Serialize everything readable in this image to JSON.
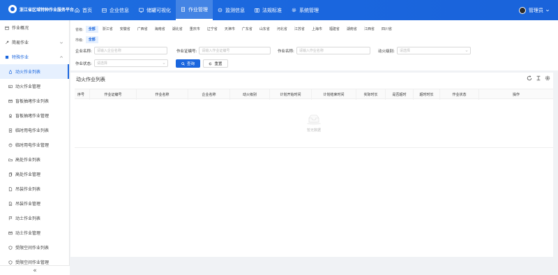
{
  "header": {
    "app_title": "浙江省区域特种作业服务平台",
    "nav": [
      {
        "label": "首页",
        "icon": "home-icon"
      },
      {
        "label": "企业信息",
        "icon": "company-icon"
      },
      {
        "label": "储罐可视化",
        "icon": "monitor-icon"
      },
      {
        "label": "作业管理",
        "icon": "document-icon",
        "active": true
      },
      {
        "label": "监测信息",
        "icon": "sensor-icon"
      },
      {
        "label": "法规标准",
        "icon": "book-icon"
      },
      {
        "label": "系统管理",
        "icon": "gear-icon"
      }
    ],
    "user": "管理员"
  },
  "sidebar": {
    "items": [
      {
        "label": "作业概况",
        "icon": "calendar-icon",
        "level": 0
      },
      {
        "label": "简易作业",
        "icon": "tool-icon",
        "level": 0,
        "chevron": "down"
      },
      {
        "label": "特殊作业",
        "icon": "square-icon",
        "level": 0,
        "chevron": "up",
        "open": true
      },
      {
        "label": "动火作业列表",
        "icon": "fire-icon",
        "level": 1,
        "active": true
      },
      {
        "label": "动火作业管理",
        "icon": "image-icon",
        "level": 1
      },
      {
        "label": "盲板抽堵作业列表",
        "icon": "mail-icon",
        "level": 1
      },
      {
        "label": "盲板抽堵作业管理",
        "icon": "badge-icon",
        "level": 1
      },
      {
        "label": "临时用电作业列表",
        "icon": "list-icon",
        "level": 1
      },
      {
        "label": "临时用电作业管理",
        "icon": "plug-icon",
        "level": 1
      },
      {
        "label": "高处作业列表",
        "icon": "folder-icon",
        "level": 1
      },
      {
        "label": "高处作业管理",
        "icon": "copy-icon",
        "level": 1
      },
      {
        "label": "吊装作业列表",
        "icon": "file-icon",
        "level": 1
      },
      {
        "label": "吊装作业管理",
        "icon": "file-check-icon",
        "level": 1
      },
      {
        "label": "动土作业列表",
        "icon": "flag-icon",
        "level": 1
      },
      {
        "label": "动土作业管理",
        "icon": "mail-icon",
        "level": 1
      },
      {
        "label": "受限空间作业列表",
        "icon": "shield-icon",
        "level": 1
      },
      {
        "label": "受限空间作业管理",
        "icon": "shield-icon",
        "level": 1
      }
    ],
    "collapse_label": "«"
  },
  "filters": {
    "province_label": "省级:",
    "provinces": [
      "全部",
      "浙江省",
      "安徽省",
      "广西省",
      "海南省",
      "湖北省",
      "重庆市",
      "辽宁省",
      "天津市",
      "广东省",
      "山东省",
      "河北省",
      "江苏省",
      "上海市",
      "福建省",
      "湖南省",
      "江西省",
      "四川省"
    ],
    "city_label": "市级:",
    "cities": [
      "全部"
    ],
    "company_name": {
      "label": "企业名称:",
      "placeholder": "请输入企业名称"
    },
    "permit_no": {
      "label": "作业证编号:",
      "placeholder": "请输入作业证编号"
    },
    "job_name": {
      "label": "作业名称:",
      "placeholder": "请输入作业名称"
    },
    "fire_level": {
      "label": "动火级别:",
      "placeholder": "请选择"
    },
    "job_status": {
      "label": "作业状态:",
      "placeholder": "请选择"
    },
    "search_label": "查询",
    "reset_label": "重置"
  },
  "table": {
    "title": "动火作业列表",
    "columns": [
      "序号",
      "作业证编号",
      "作业名称",
      "企业名称",
      "动火级别",
      "计划开始时间",
      "计划结束时间",
      "实际时长",
      "是否超时",
      "超时时长",
      "作业状态",
      "操作"
    ],
    "rows": [],
    "empty_text": "暂无数据"
  },
  "colors": {
    "primary": "#1a66de",
    "header_bg": "#1f6fe0",
    "active_bg": "#e6f0fe"
  }
}
